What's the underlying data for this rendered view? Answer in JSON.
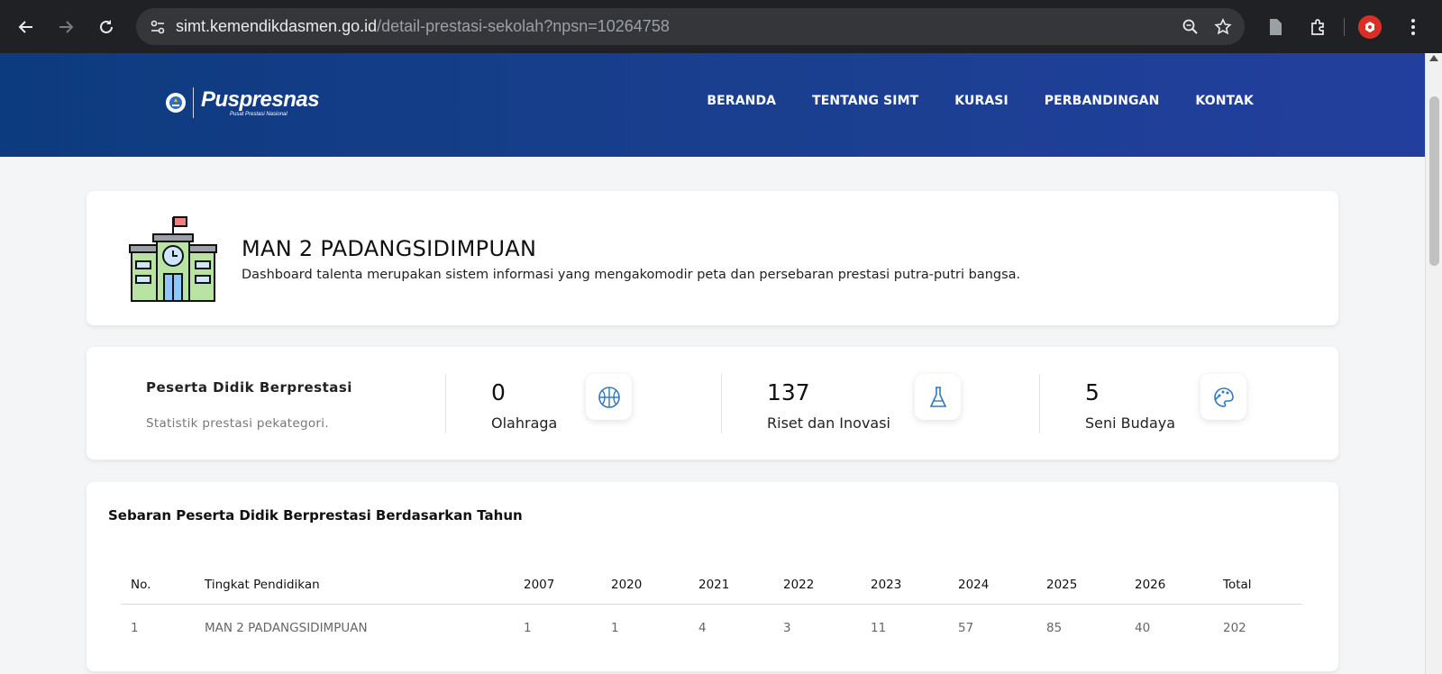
{
  "browser": {
    "url_host": "simt.kemendikdasmen.go.id",
    "url_path": "/detail-prestasi-sekolah?npsn=10264758"
  },
  "header": {
    "logo_text": "Puspresnas",
    "logo_subtext": "Pusat Prestasi Nasional",
    "nav": [
      "BERANDA",
      "TENTANG SIMT",
      "KURASI",
      "PERBANDINGAN",
      "KONTAK"
    ]
  },
  "school": {
    "name": "MAN 2 PADANGSIDIMPUAN",
    "description": "Dashboard talenta merupakan sistem informasi yang mengakomodir peta dan persebaran prestasi putra-putri bangsa."
  },
  "stats": {
    "heading": "Peserta Didik Berprestasi",
    "subheading": "Statistik prestasi pekategori.",
    "items": [
      {
        "value": "0",
        "label": "Olahraga",
        "icon": "basketball-icon"
      },
      {
        "value": "137",
        "label": "Riset dan Inovasi",
        "icon": "flask-icon"
      },
      {
        "value": "5",
        "label": "Seni Budaya",
        "icon": "palette-icon"
      }
    ]
  },
  "table": {
    "title": "Sebaran Peserta Didik Berprestasi Berdasarkan Tahun",
    "headers": [
      "No.",
      "Tingkat Pendidikan",
      "2007",
      "2020",
      "2021",
      "2022",
      "2023",
      "2024",
      "2025",
      "2026",
      "Total"
    ],
    "rows": [
      [
        "1",
        "MAN 2 PADANGSIDIMPUAN",
        "1",
        "1",
        "4",
        "3",
        "11",
        "57",
        "85",
        "40",
        "202"
      ]
    ]
  }
}
